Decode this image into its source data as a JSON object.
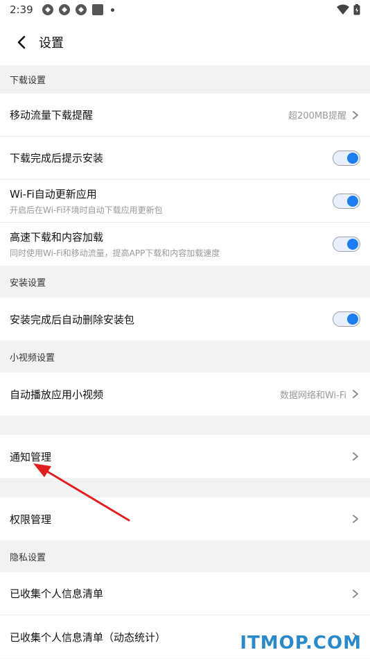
{
  "status_bar": {
    "time": "2:39"
  },
  "header": {
    "title": "设置"
  },
  "sections": {
    "download": {
      "header": "下载设置",
      "mobile_data": {
        "title": "移动流量下载提醒",
        "value": "超200MB提醒"
      },
      "install_prompt": {
        "title": "下载完成后提示安装",
        "enabled": true
      },
      "wifi_update": {
        "title": "Wi-Fi自动更新应用",
        "subtitle": "开启后在Wi-Fi环境时自动下载应用更新包",
        "enabled": true
      },
      "speed_boost": {
        "title": "高速下载和内容加载",
        "subtitle": "同时使用Wi-Fi和移动流量，提高APP下载和内容加载速度",
        "enabled": true
      }
    },
    "install": {
      "header": "安装设置",
      "auto_delete": {
        "title": "安装完成后自动删除安装包",
        "enabled": true
      }
    },
    "video": {
      "header": "小视频设置",
      "autoplay": {
        "title": "自动播放应用小视频",
        "value": "数据网络和Wi-Fi"
      }
    },
    "notification": {
      "title": "通知管理"
    },
    "permission": {
      "title": "权限管理"
    },
    "privacy": {
      "header": "隐私设置",
      "collected": {
        "title": "已收集个人信息清单"
      },
      "collected_dynamic": {
        "title": "已收集个人信息清单（动态统计）"
      }
    }
  },
  "watermark": "ITMOP.COM",
  "colors": {
    "accent": "#1e7ef0",
    "annotation_arrow": "#e02020",
    "watermark": "#2a8ac8"
  }
}
